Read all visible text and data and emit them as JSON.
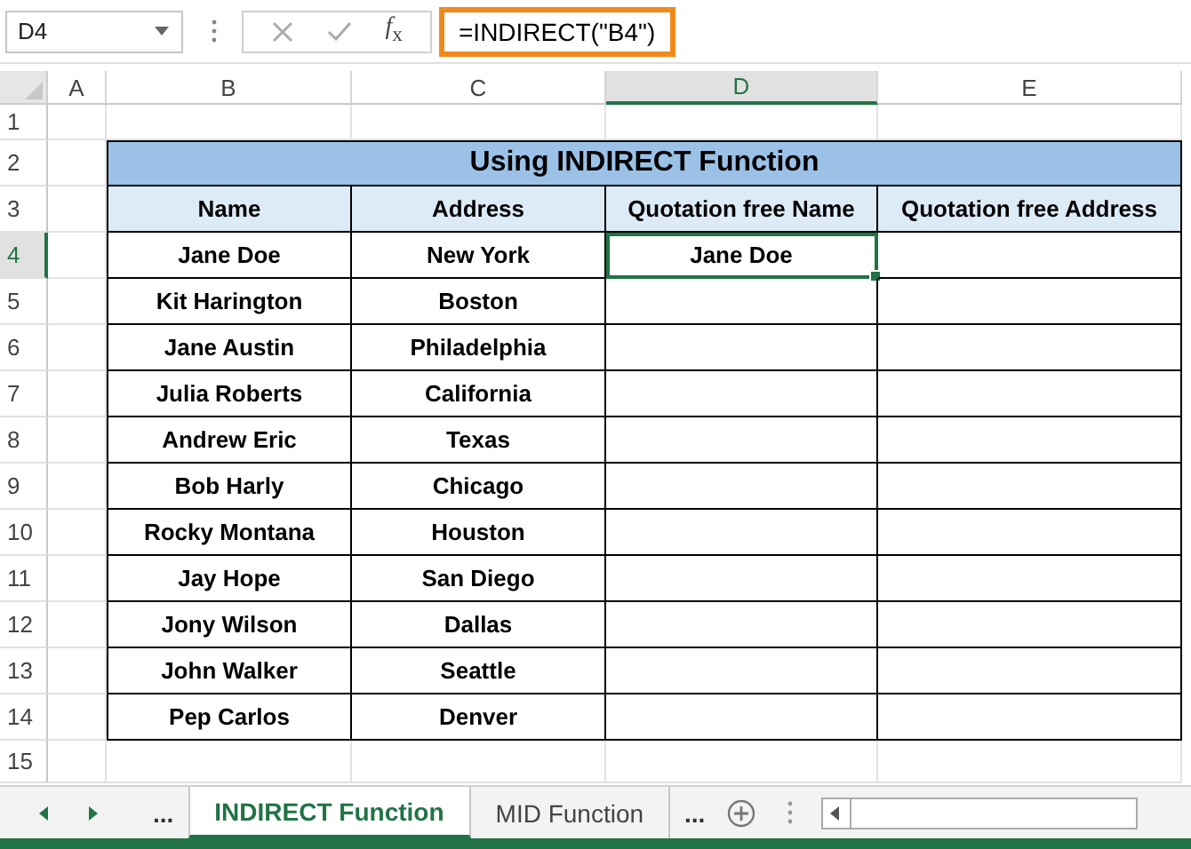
{
  "formula_bar": {
    "name_box": "D4",
    "function_label": "*f*$_{x}$",
    "formula": "=INDIRECT(\"B4\")"
  },
  "columns": [
    {
      "label": "A",
      "selected": false
    },
    {
      "label": "B",
      "selected": false
    },
    {
      "label": "C",
      "selected": false
    },
    {
      "label": "D",
      "selected": true
    },
    {
      "label": "E",
      "selected": false
    }
  ],
  "row_numbers": [
    {
      "label": "1",
      "selected": false
    },
    {
      "label": "2",
      "selected": false
    },
    {
      "label": "3",
      "selected": false
    },
    {
      "label": "4",
      "selected": true
    },
    {
      "label": "5",
      "selected": false
    },
    {
      "label": "6",
      "selected": false
    },
    {
      "label": "7",
      "selected": false
    },
    {
      "label": "8",
      "selected": false
    },
    {
      "label": "9",
      "selected": false
    },
    {
      "label": "10",
      "selected": false
    },
    {
      "label": "11",
      "selected": false
    },
    {
      "label": "12",
      "selected": false
    },
    {
      "label": "13",
      "selected": false
    },
    {
      "label": "14",
      "selected": false
    },
    {
      "label": "15",
      "selected": false
    }
  ],
  "table": {
    "title": "Using INDIRECT Function",
    "headers": [
      "Name",
      "Address",
      "Quotation free Name",
      "Quotation free Address"
    ],
    "rows": [
      [
        {
          "text": "Jane Doe",
          "selected": false
        },
        {
          "text": "New York",
          "selected": false
        },
        {
          "text": "Jane Doe",
          "selected": true
        },
        {
          "selected": false
        }
      ],
      [
        {
          "text": "Kit Harington",
          "selected": false
        },
        {
          "text": "Boston",
          "selected": false
        },
        {
          "selected": false
        },
        {
          "selected": false
        }
      ],
      [
        {
          "text": "Jane Austin",
          "selected": false
        },
        {
          "text": "Philadelphia",
          "selected": false
        },
        {
          "selected": false
        },
        {
          "selected": false
        }
      ],
      [
        {
          "text": "Julia Roberts",
          "selected": false
        },
        {
          "text": "California",
          "selected": false
        },
        {
          "selected": false
        },
        {
          "selected": false
        }
      ],
      [
        {
          "text": "Andrew Eric",
          "selected": false
        },
        {
          "text": "Texas",
          "selected": false
        },
        {
          "selected": false
        },
        {
          "selected": false
        }
      ],
      [
        {
          "text": "Bob Harly",
          "selected": false
        },
        {
          "text": "Chicago",
          "selected": false
        },
        {
          "selected": false
        },
        {
          "selected": false
        }
      ],
      [
        {
          "text": "Rocky Montana",
          "selected": false
        },
        {
          "text": "Houston",
          "selected": false
        },
        {
          "selected": false
        },
        {
          "selected": false
        }
      ],
      [
        {
          "text": "Jay Hope",
          "selected": false
        },
        {
          "text": "San Diego",
          "selected": false
        },
        {
          "selected": false
        },
        {
          "selected": false
        }
      ],
      [
        {
          "text": "Jony Wilson",
          "selected": false
        },
        {
          "text": "Dallas",
          "selected": false
        },
        {
          "selected": false
        },
        {
          "selected": false
        }
      ],
      [
        {
          "text": "John Walker",
          "selected": false
        },
        {
          "text": "Seattle",
          "selected": false
        },
        {
          "selected": false
        },
        {
          "selected": false
        }
      ],
      [
        {
          "text": "Pep Carlos",
          "selected": false
        },
        {
          "text": "Denver",
          "selected": false
        },
        {
          "selected": false
        },
        {
          "selected": false
        }
      ]
    ]
  },
  "sheet_bar": {
    "left_more": "...",
    "tabs": [
      {
        "label": "INDIRECT Function",
        "selected": true
      },
      {
        "label": "MID Function",
        "selected": false
      }
    ],
    "right_more": "..."
  }
}
